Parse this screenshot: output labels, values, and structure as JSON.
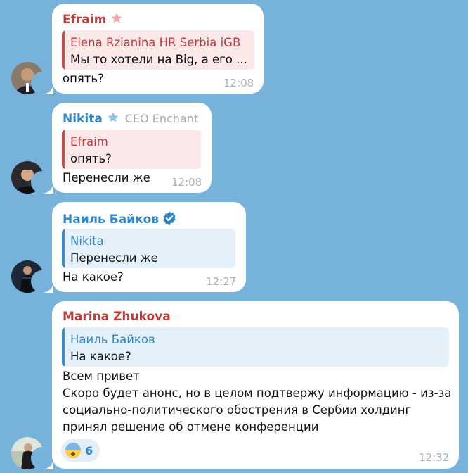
{
  "colors": {
    "background": "#77b2da",
    "bubble": "#ffffff",
    "name_red": "#c23b3b",
    "name_blue": "#2f86c8",
    "time": "#a8b0b9"
  },
  "messages": [
    {
      "sender": "Efraim",
      "sender_icon": "star-icon",
      "reply": {
        "name": "Elena Rzianina HR Serbia iGB",
        "text": "Мы то хотели на Big, а его ..."
      },
      "text": "опять?",
      "time": "12:08"
    },
    {
      "sender": "Nikita",
      "sender_icon": "star-icon",
      "sender_title": "CEO Enchant",
      "reply": {
        "name": "Efraim",
        "text": "опять?"
      },
      "text": "Перенесли же",
      "time": "12:08"
    },
    {
      "sender": "Наиль Байков",
      "sender_icon": "verified-badge-icon",
      "reply": {
        "name": "Nikita",
        "text": "Перенесли же"
      },
      "text": "На какое?",
      "time": "12:27"
    },
    {
      "sender": "Marina Zhukova",
      "reply": {
        "name": "Наиль Байков",
        "text": "На какое?"
      },
      "lines": [
        "Всем привет",
        "Скоро будет анонс, но в целом подтвержу информацию - из-за",
        "социально-политического обострения в Сербии холдинг",
        "принял решение об отмене конференции"
      ],
      "reaction": {
        "emoji": "fearful-face-emoji",
        "count": "6"
      },
      "time": "12:32"
    }
  ]
}
